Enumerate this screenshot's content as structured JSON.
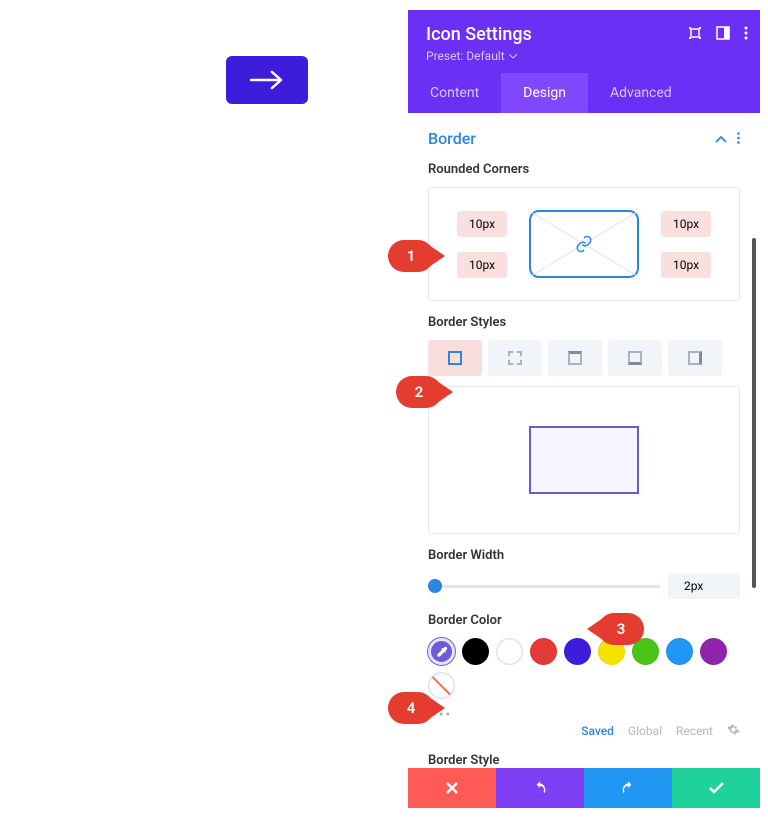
{
  "canvas": {
    "icon_name": "arrow-right"
  },
  "panel": {
    "title": "Icon Settings",
    "preset_label": "Preset: Default"
  },
  "tabs": [
    {
      "label": "Content",
      "active": false
    },
    {
      "label": "Design",
      "active": true
    },
    {
      "label": "Advanced",
      "active": false
    }
  ],
  "section": {
    "title": "Border"
  },
  "rounded_corners": {
    "label": "Rounded Corners",
    "tl": "10px",
    "tr": "10px",
    "bl": "10px",
    "br": "10px"
  },
  "border_styles": {
    "label": "Border Styles"
  },
  "border_width": {
    "label": "Border Width",
    "value": "2px"
  },
  "border_color": {
    "label": "Border Color",
    "picker": "#6d5cd9",
    "swatches": [
      "#000000",
      "#ffffff",
      "#e53935",
      "#3d1ddb",
      "#f3e400",
      "#4cc417",
      "#2196f3",
      "#8e24aa"
    ]
  },
  "filters": {
    "saved": "Saved",
    "global": "Global",
    "recent": "Recent"
  },
  "border_style": {
    "label": "Border Style"
  },
  "callouts": {
    "c1": "1",
    "c2": "2",
    "c3": "3",
    "c4": "4"
  }
}
